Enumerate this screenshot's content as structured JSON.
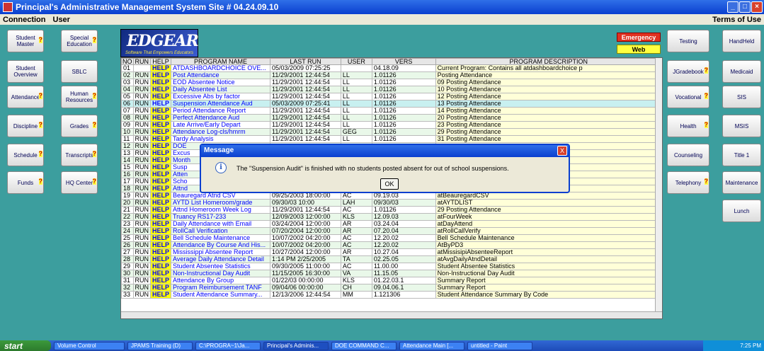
{
  "window": {
    "title": "Principal's Administrative Management System  Site # 04.24.09.10"
  },
  "menu": {
    "connection": "Connection",
    "user": "User",
    "terms": "Terms of Use"
  },
  "left_nav": {
    "student_master": "Student Master",
    "special_education": "Special Education",
    "student_overview": "Student Overview",
    "sblc": "SBLC",
    "attendance": "Attendance",
    "human_resources": "Human Resources",
    "discipline": "Discipline",
    "grades": "Grades",
    "schedule": "Schedule",
    "transcripts": "Transcripts",
    "funds": "Funds",
    "hq_center": "HQ Center",
    "help_mark": "?"
  },
  "logo": {
    "main": "EDGEAR",
    "tagline": "Software That Empowers Educators"
  },
  "top_buttons": {
    "emergency": "Emergency",
    "web": "Web"
  },
  "right_nav": {
    "testing": "Testing",
    "handheld": "HandHeld",
    "jgradebook": "JGradebook",
    "medicaid": "Medicaid",
    "vocational": "Vocational",
    "sis": "SIS",
    "health": "Health",
    "msis": "MSIS",
    "counseling": "Counseling",
    "title1": "Title 1",
    "telephony": "Telephony",
    "maintenance": "Maintenance",
    "lunch": "Lunch"
  },
  "table": {
    "headers": [
      "NO",
      "RUN",
      "HELP",
      "PROGRAM NAME",
      "LAST RUN",
      "USER",
      "VERS",
      "PROGRAM DESCRIPTION"
    ],
    "rows": [
      [
        "01",
        "",
        "HELP",
        "ATDASHBOARDCHOICE OVE...",
        "05/03/2009 07:25:25",
        "",
        "04.18.09",
        "Current Program: Contains all atdashboardchoice p"
      ],
      [
        "02",
        "RUN",
        "HELP",
        "Post Attendance",
        "11/29/2001 12:44:54",
        "LL",
        "1.01126",
        "Posting Attendance"
      ],
      [
        "03",
        "RUN",
        "HELP",
        "EOD Absentee Notice",
        "11/29/2001 12:44:54",
        "LL",
        "1.01126",
        "09 Posting Attendance"
      ],
      [
        "04",
        "RUN",
        "HELP",
        "Daily Absentee List",
        "11/29/2001 12:44:54",
        "LL",
        "1.01126",
        "10 Posting Attendance"
      ],
      [
        "05",
        "RUN",
        "HELP",
        "Excessive Abs by factor",
        "11/29/2001 12:44:54",
        "LL",
        "1.01126",
        "12 Posting Attendance"
      ],
      [
        "06",
        "RUN",
        "HELP",
        "Suspension Attendance Aud",
        "05/03/2009 07:25:41",
        "LL",
        "1.01126",
        "13 Posting Attendance"
      ],
      [
        "07",
        "RUN",
        "HELP",
        "Period Attendance Report",
        "11/29/2001 12:44:54",
        "LL",
        "1.01126",
        "14 Posting Attendance"
      ],
      [
        "08",
        "RUN",
        "HELP",
        "Perfect Attendance Aud",
        "11/29/2001 12:44:54",
        "LL",
        "1.01126",
        "20 Posting Attendance"
      ],
      [
        "09",
        "RUN",
        "HELP",
        "Late Arrive/Early Depart",
        "11/29/2001 12:44:54",
        "LL",
        "1.01126",
        "23 Posting Attendance"
      ],
      [
        "10",
        "RUN",
        "HELP",
        "Attendance Log-cls/hmrm",
        "11/29/2001 12:44:54",
        "GEG",
        "1.01126",
        "29 Posting Attendance"
      ],
      [
        "11",
        "RUN",
        "HELP",
        "Tardy Analysis",
        "11/29/2001 12:44:54",
        "LL",
        "1.01126",
        "31 Posting Attendance"
      ],
      [
        "12",
        "RUN",
        "HELP",
        "DOE",
        "",
        "",
        "",
        ""
      ],
      [
        "13",
        "RUN",
        "HELP",
        "Excus",
        "",
        "",
        "",
        ""
      ],
      [
        "14",
        "RUN",
        "HELP",
        "Month",
        "",
        "",
        "",
        ""
      ],
      [
        "15",
        "RUN",
        "HELP",
        "Susp",
        "",
        "",
        "",
        "e"
      ],
      [
        "16",
        "RUN",
        "HELP",
        "Atten",
        "",
        "",
        "",
        "ds"
      ],
      [
        "17",
        "RUN",
        "HELP",
        "Scho",
        "",
        "",
        "",
        ""
      ],
      [
        "18",
        "RUN",
        "HELP",
        "Attnd",
        "",
        "",
        "",
        ""
      ],
      [
        "19",
        "RUN",
        "HELP",
        "Beauregard Atnd CSV",
        "09/25/2003 18:00:00",
        "AC",
        "09.19.03",
        "atBeauregardCSV"
      ],
      [
        "20",
        "RUN",
        "HELP",
        "AYTD List Homeroom/grade",
        "09/30/03 10:00",
        "LAH",
        "09/30/03",
        "atAYTDLIST"
      ],
      [
        "21",
        "RUN",
        "HELP",
        "Attnd Homeroom Week Log",
        "11/29/2001 12:44:54",
        "AC",
        "1.01126",
        "29 Posting Attendance"
      ],
      [
        "22",
        "RUN",
        "HELP",
        "Truancy RS17-233",
        "12/09/2003 12:00:00",
        "KLS",
        "12.09.03",
        "atFourWeek"
      ],
      [
        "23",
        "RUN",
        "HELP",
        "Daily Attendance with Email",
        "03/24/2004 12:00:00",
        "AR",
        "03.24.04",
        "atDayAttend"
      ],
      [
        "24",
        "RUN",
        "HELP",
        "RollCall Verification",
        "07/20/2004 12:00:00",
        "AR",
        "07.20.04",
        "atRollCallVerify"
      ],
      [
        "25",
        "RUN",
        "HELP",
        "Bell Schedule Maintenance",
        "10/07/2002 04:20:00",
        "AC",
        "12.20.02",
        "Bell Schedule Maintenance"
      ],
      [
        "26",
        "RUN",
        "HELP",
        "Attendance By Course And His...",
        "10/07/2002 04:20:00",
        "AC",
        "12.20.02",
        "AtByPD3"
      ],
      [
        "27",
        "RUN",
        "HELP",
        "Mississippi Absentee Report",
        "10/27/2004 12:00:00",
        "AR",
        "10.27.04",
        "atMissisipiAbsenteeReport"
      ],
      [
        "28",
        "RUN",
        "HELP",
        "Average Daily Attendance Detail",
        "1:14 PM 2/25/2005",
        "TA",
        "02.25.05",
        "atAvgDailyAtndDetail"
      ],
      [
        "29",
        "RUN",
        "HELP",
        "Student Absentee Statistics",
        "09/30/2005 11:00:00",
        "AC",
        "11.00.00",
        "Student Absentee Statistics"
      ],
      [
        "30",
        "RUN",
        "HELP",
        "Non-Instructional Day Audit",
        "11/15/2005 16:30:00",
        "VA",
        "11.15.05",
        "Non-Instructional Day Audit"
      ],
      [
        "31",
        "RUN",
        "HELP",
        "Attendance By Group",
        "01/22/03 00:00:00",
        "KLS",
        "01.22.03.1",
        "Summary Report"
      ],
      [
        "32",
        "RUN",
        "HELP",
        "Program Reimbursement TANF",
        "09/04/06 00:00:00",
        "CH",
        "09.04.06.1",
        "Summary Report"
      ],
      [
        "33",
        "RUN",
        "HELP",
        "Student Attendance Summary...",
        "12/13/2006 12:44:54",
        "MM",
        "1.121306",
        "Student Attendance Summary By Code"
      ]
    ]
  },
  "dialog": {
    "title": "Message",
    "message": "The \"Suspension Audit\" is finished with no students posted absent for out of school suspensions.",
    "ok": "OK",
    "close": "X",
    "info": "i"
  },
  "taskbar": {
    "start": "start",
    "tasks": [
      "Volume Control",
      "JPAMS Training (D)",
      "C:\\PROGRA~1\\Ja...",
      "Principal's Adminis...",
      "DOE COMMAND C...",
      "Attendance Main [...",
      "untitled - Paint"
    ],
    "clock": "7:25 PM"
  }
}
